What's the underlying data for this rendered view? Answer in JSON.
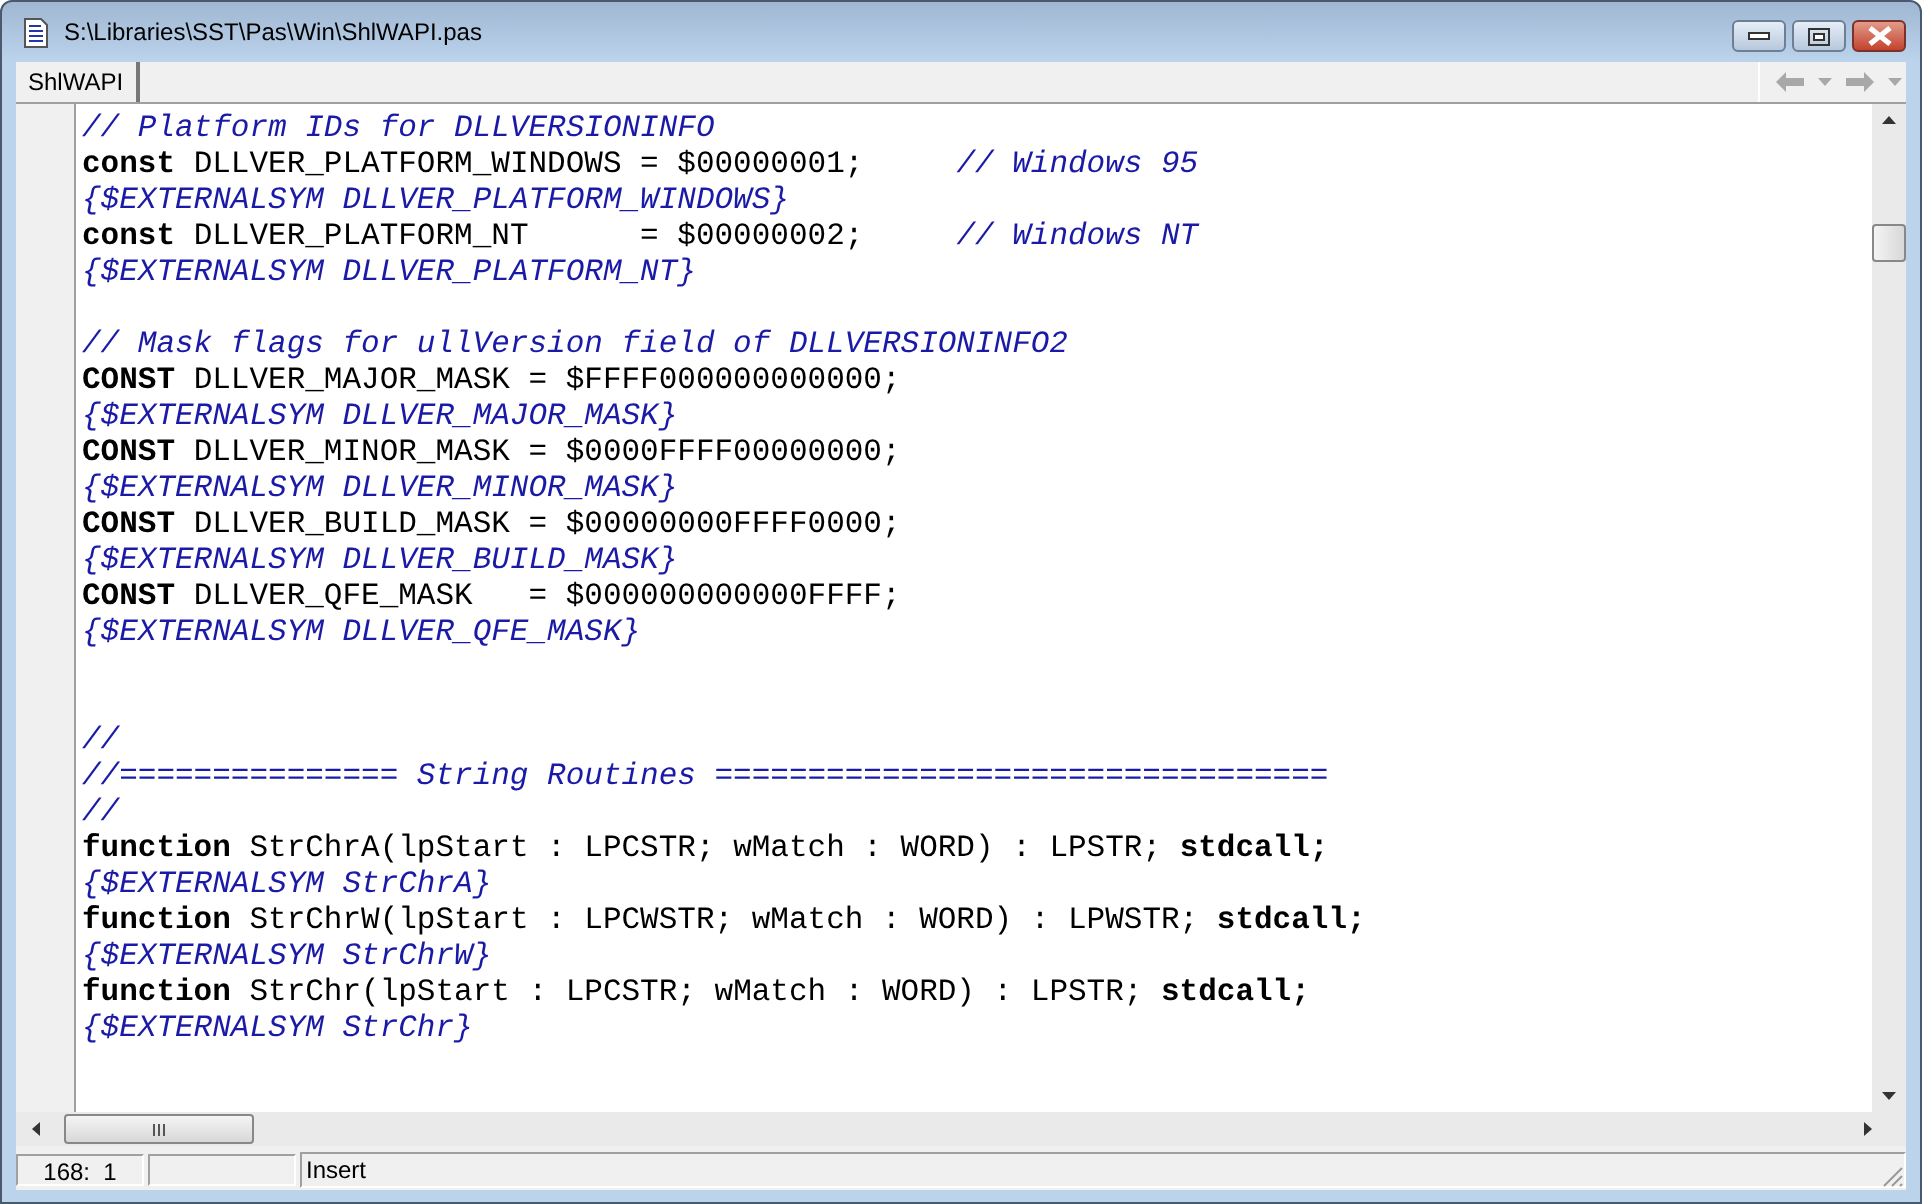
{
  "window": {
    "title": "S:\\Libraries\\SST\\Pas\\Win\\ShlWAPI.pas"
  },
  "tabs": [
    {
      "label": "ShlWAPI",
      "selected": true
    }
  ],
  "editor": {
    "lines": [
      {
        "kind": "comment",
        "text": "// Platform IDs for DLLVERSIONINFO"
      },
      {
        "kind": "code",
        "text": "**const** DLLVER_PLATFORM_WINDOWS = $00000001;     *// Windows 95*"
      },
      {
        "kind": "comment",
        "text": "{$EXTERNALSYM DLLVER_PLATFORM_WINDOWS}"
      },
      {
        "kind": "code",
        "text": "**const** DLLVER_PLATFORM_NT      = $00000002;     *// Windows NT*"
      },
      {
        "kind": "comment",
        "text": "{$EXTERNALSYM DLLVER_PLATFORM_NT}"
      },
      {
        "kind": "blank"
      },
      {
        "kind": "comment",
        "text": "// Mask flags for ullVersion field of DLLVERSIONINFO2"
      },
      {
        "kind": "code",
        "text": "**CONST** DLLVER_MAJOR_MASK = $FFFF000000000000;"
      },
      {
        "kind": "comment",
        "text": "{$EXTERNALSYM DLLVER_MAJOR_MASK}"
      },
      {
        "kind": "code",
        "text": "**CONST** DLLVER_MINOR_MASK = $0000FFFF00000000;"
      },
      {
        "kind": "comment",
        "text": "{$EXTERNALSYM DLLVER_MINOR_MASK}"
      },
      {
        "kind": "code",
        "text": "**CONST** DLLVER_BUILD_MASK = $00000000FFFF0000;"
      },
      {
        "kind": "comment",
        "text": "{$EXTERNALSYM DLLVER_BUILD_MASK}"
      },
      {
        "kind": "code",
        "text": "**CONST** DLLVER_QFE_MASK   = $000000000000FFFF;"
      },
      {
        "kind": "comment",
        "text": "{$EXTERNALSYM DLLVER_QFE_MASK}"
      },
      {
        "kind": "blank"
      },
      {
        "kind": "blank"
      },
      {
        "kind": "comment",
        "text": "//"
      },
      {
        "kind": "comment",
        "text": "//=============== String Routines ================================="
      },
      {
        "kind": "comment",
        "text": "//"
      },
      {
        "kind": "code",
        "text": "**function** StrChrA(lpStart : LPCSTR; wMatch : WORD) : LPSTR; **stdcall;**"
      },
      {
        "kind": "comment",
        "text": "{$EXTERNALSYM StrChrA}"
      },
      {
        "kind": "code",
        "text": "**function** StrChrW(lpStart : LPCWSTR; wMatch : WORD) : LPWSTR; **stdcall;**"
      },
      {
        "kind": "comment",
        "text": "{$EXTERNALSYM StrChrW}"
      },
      {
        "kind": "code",
        "text": "**function** StrChr(lpStart : LPCSTR; wMatch : WORD) : LPSTR; **stdcall;**"
      },
      {
        "kind": "comment",
        "text": "{$EXTERNALSYM StrChr}"
      }
    ]
  },
  "status_bar": {
    "position": "168:  1",
    "mode": "Insert"
  }
}
